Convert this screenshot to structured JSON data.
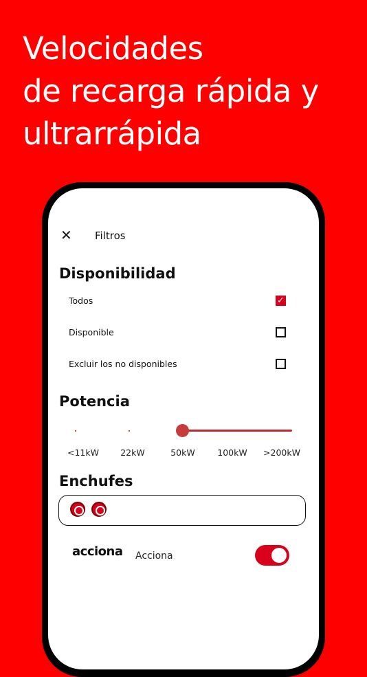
{
  "headline": {
    "line1": "Velocidades",
    "line2": "de recarga rápida y",
    "line3": "ultrarrápida"
  },
  "filters": {
    "close_icon": "close-icon",
    "title": "Filtros"
  },
  "availability": {
    "heading": "Disponibilidad",
    "options": [
      {
        "label": "Todos",
        "checked": true
      },
      {
        "label": "Disponible",
        "checked": false
      },
      {
        "label": "Excluir los no disponibles",
        "checked": false
      }
    ]
  },
  "power": {
    "heading": "Potencia",
    "ticks": [
      "<11kW",
      "22kW",
      "50kW",
      "100kW",
      ">200kW"
    ],
    "selected_from": "50kW",
    "selected_to": ">200kW"
  },
  "plugs": {
    "heading": "Enchufes",
    "items": [
      "plug-type-icon",
      "plug-type-icon"
    ]
  },
  "operator": {
    "logo_text": "acciona",
    "label": "Acciona",
    "enabled": true
  },
  "colors": {
    "background": "#ff0000",
    "accent": "#d9001b"
  }
}
